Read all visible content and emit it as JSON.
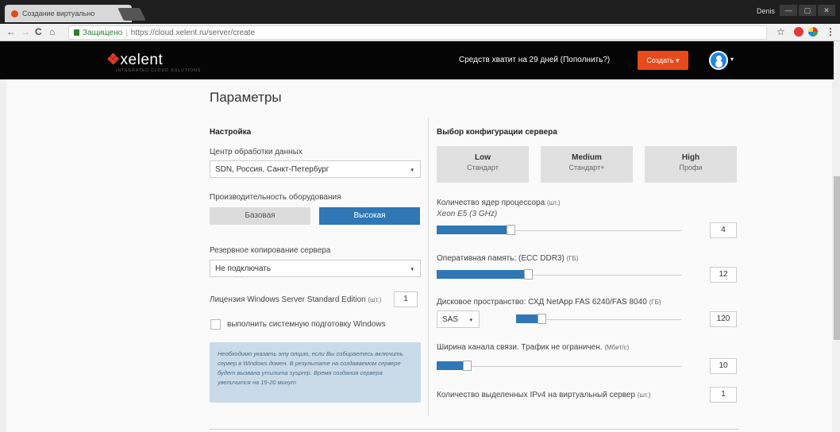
{
  "browser": {
    "tab_title": "Создание виртуально",
    "tab_close": "✕",
    "window_user": "Denis",
    "win_min": "—",
    "win_max": "▢",
    "win_close": "✕",
    "nav_back": "←",
    "nav_forward": "→",
    "nav_reload": "C",
    "nav_home": "⌂",
    "secure_label": "Защищено",
    "separator": "|",
    "url": "https://cloud.xelent.ru/server/create",
    "bookmark_star": "☆"
  },
  "header": {
    "logo": "xelent",
    "logo_mark": "❖",
    "logo_tagline": "INTEGRATED CLOUD SOLUTIONS",
    "funds_text": "Средств хватит на 29 дней (Пополнить?)",
    "create_button": "Создать ▾",
    "avatar_caret": "▾"
  },
  "page": {
    "title": "Параметры"
  },
  "settings": {
    "section_title": "Настройка",
    "datacenter_label": "Центр обработки данных",
    "datacenter_value": "SDN, Россия, Санкт-Петербург",
    "performance_label": "Производительность оборудования",
    "perf_base": "Базовая",
    "perf_high": "Высокая",
    "backup_label": "Резервное копирование сервера",
    "backup_value": "Не подключать",
    "license_label": "Лицензия Windows Server Standard Edition",
    "license_unit": "(шт.)",
    "license_value": "1",
    "sysprep_label": "выполнить системную подготовку Windows",
    "sysprep_checked": false,
    "info_text": "Необходимо указать эту опцию, если Вы собираетесь включить сервер в Windows домен. В результате на создаваемом сервере будет вызвана утилита sysprep. Время создания сервера увеличится на 15-20 минут",
    "select_caret": "▾"
  },
  "config": {
    "section_title": "Выбор конфигурации сервера",
    "presets": [
      {
        "title": "Low",
        "subtitle": "Стандарт"
      },
      {
        "title": "Medium",
        "subtitle": "Стандарт+"
      },
      {
        "title": "High",
        "subtitle": "Профи"
      }
    ],
    "cpu": {
      "label": "Количество ядер процессора",
      "unit": "(шт.)",
      "sub": "Xeon E5 (3 GHz)",
      "value": "4",
      "fill_fraction": 0.3
    },
    "ram": {
      "label": "Оперативная память: (ECC DDR3)",
      "unit": "(ГБ)",
      "value": "12",
      "fill_fraction": 0.37
    },
    "disk": {
      "label": "Дисковое пространство: СХД NetApp FAS 6240/FAS 8040",
      "unit": "(ГБ)",
      "type": "SAS",
      "type_caret": "▾",
      "value": "120",
      "fill_fraction": 0.15
    },
    "bandwidth": {
      "label": "Ширина канала связи. Трафик не ограничен.",
      "unit": "(Мбит/с)",
      "value": "10",
      "fill_fraction": 0.12
    },
    "ipv4": {
      "label": "Количество выделенных IPv4 на виртуальный сервер",
      "unit": "(шт.)",
      "value": "1"
    }
  },
  "colors": {
    "accent": "#2f77b5",
    "create": "#e84a1c",
    "header_bg": "#050505"
  }
}
